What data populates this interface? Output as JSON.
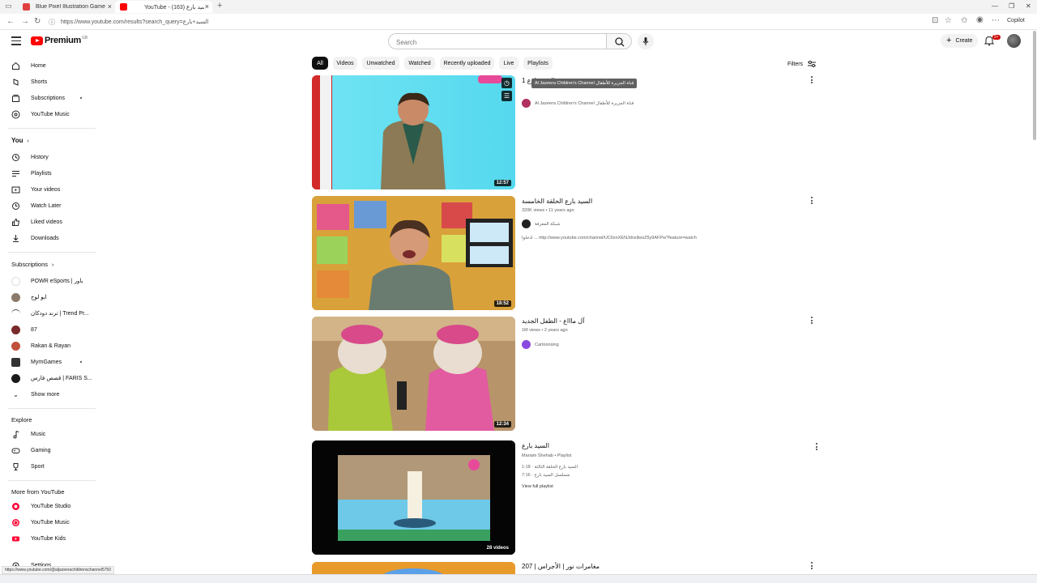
{
  "browser": {
    "tabs": [
      {
        "title": "Blue Pixel Illustration Game Prese...",
        "favicon_color": "#e04040"
      },
      {
        "title": "YouTube - السيد بارع (163)",
        "favicon_color": "#ff0000"
      }
    ],
    "url": "https://www.youtube.com/results?search_query=السيد+بارع",
    "copilot_label": "Copilot",
    "status_url": "https://www.youtube.com/@aljazeerachildrenschannel5750"
  },
  "header": {
    "logo_text": "Premium",
    "logo_sup": "GB",
    "search_placeholder": "Search",
    "create_label": "Create",
    "notif_count": "9+"
  },
  "sidebar": {
    "main": [
      {
        "label": "Home",
        "icon": "home-icon"
      },
      {
        "label": "Shorts",
        "icon": "shorts-icon"
      },
      {
        "label": "Subscriptions",
        "icon": "subscriptions-icon"
      },
      {
        "label": "YouTube Music",
        "icon": "music-disc-icon"
      }
    ],
    "you_heading": "You",
    "you": [
      {
        "label": "History",
        "icon": "history-icon"
      },
      {
        "label": "Playlists",
        "icon": "playlists-icon"
      },
      {
        "label": "Your videos",
        "icon": "your-videos-icon"
      },
      {
        "label": "Watch Later",
        "icon": "clock-icon"
      },
      {
        "label": "Liked videos",
        "icon": "thumbs-up-icon"
      },
      {
        "label": "Downloads",
        "icon": "download-icon"
      }
    ],
    "subs_heading": "Subscriptions",
    "subs": [
      {
        "label": "POWR eSports | باور",
        "color": "#ffffff"
      },
      {
        "label": "ابو لوح",
        "color": "#8a7a6a"
      },
      {
        "label": "ترند دودكان | Trend Pr...",
        "color": "#ffffff"
      },
      {
        "label": "87",
        "color": "#7a2a2a"
      },
      {
        "label": "Rakan & Rayan",
        "color": "#c0503a"
      },
      {
        "label": "MyrnGames",
        "color": "#333333"
      },
      {
        "label": "قصص فارس | FARIS S...",
        "color": "#1a1a1a"
      }
    ],
    "show_more": "Show more",
    "explore_heading": "Explore",
    "explore": [
      {
        "label": "Music",
        "icon": "music-note-icon"
      },
      {
        "label": "Gaming",
        "icon": "gaming-icon"
      },
      {
        "label": "Sport",
        "icon": "trophy-icon"
      }
    ],
    "more_heading": "More from YouTube",
    "more": [
      {
        "label": "YouTube Studio",
        "color": "#ff0033"
      },
      {
        "label": "YouTube Music",
        "color": "#ff0033"
      },
      {
        "label": "YouTube Kids",
        "color": "#ff0033"
      }
    ],
    "settings": "Settings"
  },
  "chips": [
    "All",
    "Videos",
    "Unwatched",
    "Watched",
    "Recently uploaded",
    "Live",
    "Playlists"
  ],
  "filters_label": "Filters",
  "results": [
    {
      "title": "السيد بارع 1",
      "meta": "",
      "channel": "Al Jazeera Children's Channel قناة الجزيرة للأطفال",
      "tooltip": "Al Jazeera Children's Channel قناة الجزيرة للأطفال",
      "duration": "12:57"
    },
    {
      "title": "السيد بارع الحلقة الخامسة",
      "meta": "320K views • 11 years ago",
      "channel": "شبكة المعرفة",
      "desc": "ادخلوا ... http://www.youtube.com/channel/UC6xnXENJdnxllwoZ5y9AFPw?feature=watch",
      "duration": "18:52"
    },
    {
      "title": "آل ماااع - الطفل الجديد",
      "meta": "1M views • 2 years ago",
      "channel": "Cartoonsing",
      "duration": "12:34"
    },
    {
      "title": "السيد بارع",
      "meta": "Mariam Shehab • Playlist",
      "line1": "السيد بارع الحلقة الثالثة · 1:18",
      "line2": "مسلسل السيد بارع · 7:16",
      "view_full": "View full playlist",
      "duration": "28 videos"
    },
    {
      "title": "مغامرات نور | الأجراس | 207"
    }
  ]
}
